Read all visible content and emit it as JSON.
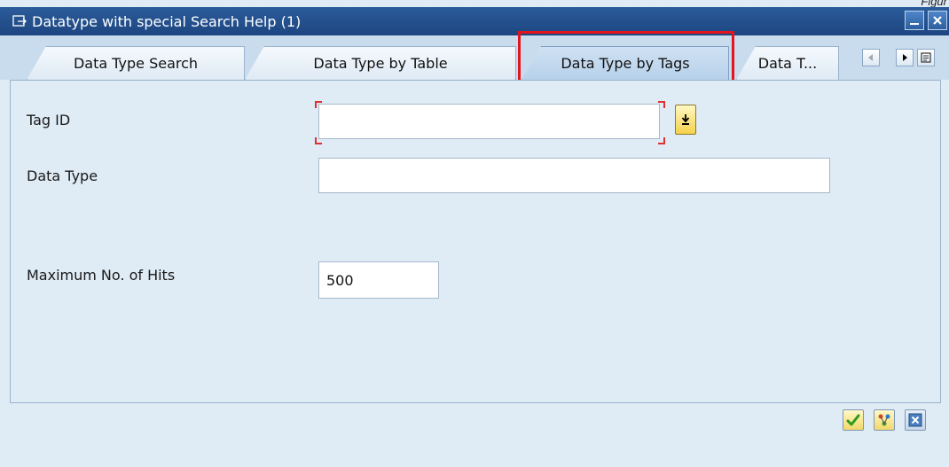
{
  "corner_text": "Figur",
  "window": {
    "title": "Datatype with special Search Help (1)"
  },
  "tabs": [
    {
      "label": "Data Type Search"
    },
    {
      "label": "Data Type by Table"
    },
    {
      "label": "Data Type by Tags",
      "active": true
    },
    {
      "label": "Data T..."
    }
  ],
  "form": {
    "tag_id": {
      "label": "Tag ID",
      "value": ""
    },
    "data_type": {
      "label": "Data Type",
      "value": ""
    },
    "max_hits": {
      "label": "Maximum No. of Hits",
      "value": "500"
    }
  },
  "footer_buttons": [
    {
      "icon": "checkmark-icon"
    },
    {
      "icon": "multiple-selection-icon"
    },
    {
      "icon": "cancel-icon"
    }
  ],
  "colors": {
    "titlebar": "#1d4681",
    "highlight": "#e3141b",
    "background": "#dfebf5"
  }
}
